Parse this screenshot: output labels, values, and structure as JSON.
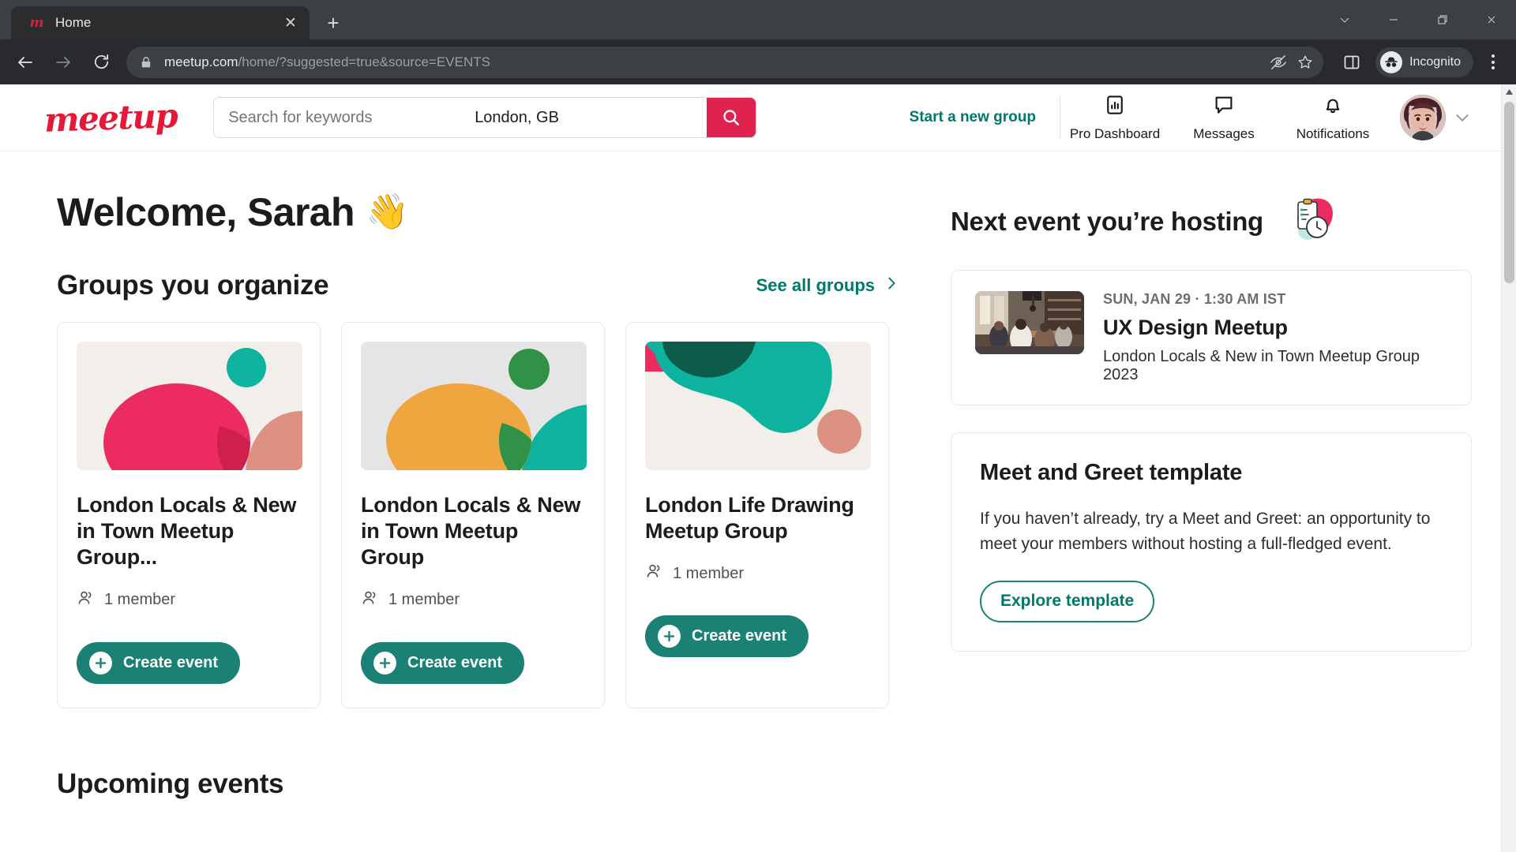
{
  "browser": {
    "tab": {
      "title": "Home",
      "favicon": "meetup-favicon",
      "close": "✕"
    },
    "new_tab": "+",
    "url_domain": "meetup.com",
    "url_path": "/home/?suggested=true&source=EVENTS",
    "incognito_label": "Incognito",
    "window_controls": [
      "chevron-down",
      "minimize",
      "restore",
      "close"
    ],
    "omnibox_icons": [
      "eye-off-icon",
      "bookmark-star-icon"
    ],
    "toolbar_icons": [
      "side-panel-icon"
    ]
  },
  "header": {
    "logo": "meetup",
    "search_keywords_placeholder": "Search for keywords",
    "search_keywords_value": "",
    "search_location_placeholder": "Location",
    "search_location_value": "London, GB",
    "search_button": "search-icon",
    "start_group": "Start a new group",
    "nav": [
      {
        "label": "Pro Dashboard",
        "icon": "bar-chart-icon"
      },
      {
        "label": "Messages",
        "icon": "speech-bubble-icon"
      },
      {
        "label": "Notifications",
        "icon": "bell-icon"
      }
    ],
    "avatar": "user-avatar",
    "avatar_caret": "chevron-down-icon"
  },
  "main": {
    "welcome": "Welcome, Sarah",
    "welcome_emoji": "👋",
    "groups_section_title": "Groups you organize",
    "see_all_groups": "See all groups",
    "groups": [
      {
        "name": "London Locals & New in Town Meetup Group...",
        "members": "1 member",
        "create_event": "Create event",
        "art": "pink-ellipse-teal-circle"
      },
      {
        "name": "London Locals & New in Town Meetup Group",
        "members": "1 member",
        "create_event": "Create event",
        "art": "orange-ellipse-green-circle"
      },
      {
        "name": "London Life Drawing Meetup Group",
        "members": "1 member",
        "create_event": "Create event",
        "art": "teal-blob-salmon-circle"
      }
    ],
    "upcoming_events_title": "Upcoming events"
  },
  "sidebar": {
    "next_event_title": "Next event you’re hosting",
    "next_event_emoji": "clipboard-clock-icon",
    "event": {
      "date": "SUN, JAN 29 · 1:30 AM IST",
      "name": "UX Design Meetup",
      "group": "London Locals & New in Town Meetup Group 2023",
      "thumb": "meetup-photo"
    },
    "template": {
      "title": "Meet and Greet template",
      "body": "If you haven’t already, try a Meet and Greet: an opportunity to meet your members without hosting a full-fledged event.",
      "cta": "Explore template"
    }
  },
  "colors": {
    "brand_red": "#e0224e",
    "teal": "#1b8175",
    "link_teal": "#00796b",
    "text": "#1c1c1c"
  }
}
